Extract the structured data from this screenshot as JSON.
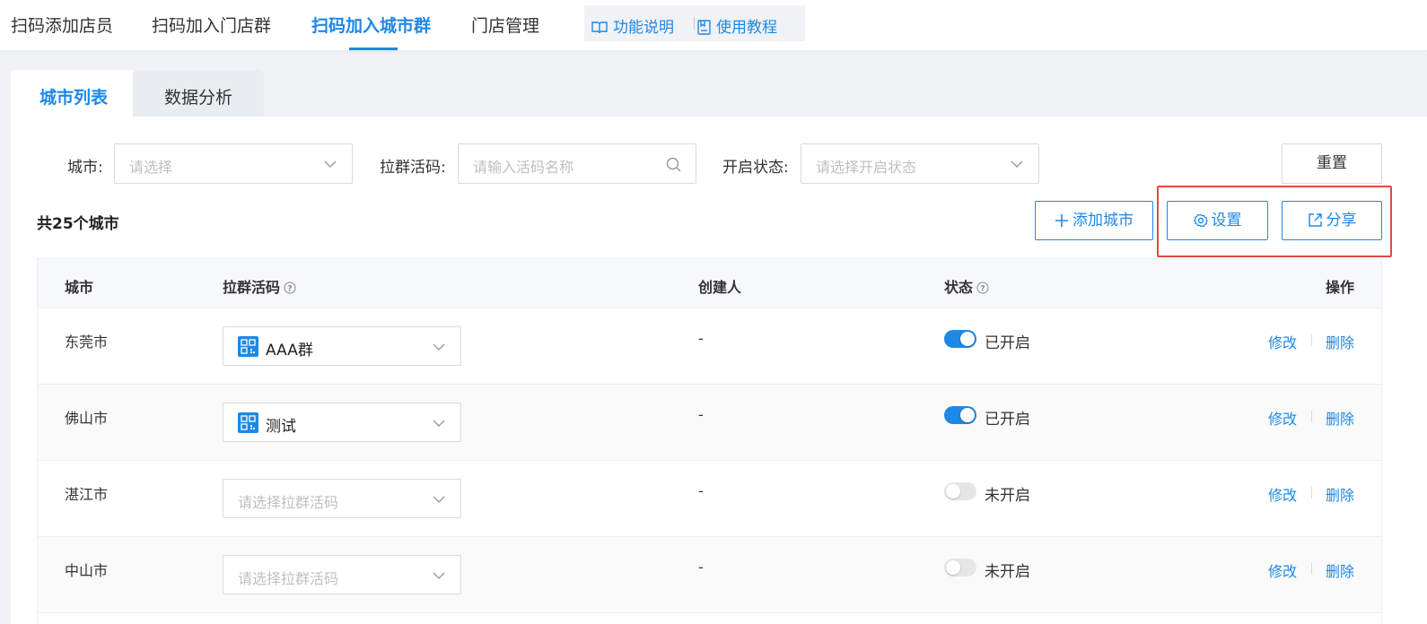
{
  "nav": {
    "tabs": [
      "扫码添加店员",
      "扫码加入门店群",
      "扫码加入城市群",
      "门店管理"
    ],
    "active_index": 2,
    "feature_label": "功能说明",
    "tutorial_label": "使用教程"
  },
  "subtabs": [
    "城市列表",
    "数据分析"
  ],
  "filters": {
    "city_label": "城市:",
    "city_placeholder": "请选择",
    "code_label": "拉群活码:",
    "code_placeholder": "请输入活码名称",
    "status_label": "开启状态:",
    "status_placeholder": "请选择开启状态",
    "reset_label": "重置"
  },
  "summary": "共25个城市",
  "actions": {
    "add_city": "添加城市",
    "settings": "设置",
    "share": "分享"
  },
  "table": {
    "headers": {
      "city": "城市",
      "code": "拉群活码",
      "creator": "创建人",
      "status": "状态",
      "ops": "操作"
    },
    "rows": [
      {
        "city": "东莞市",
        "code": "AAA群",
        "code_placeholder": "",
        "creator": "-",
        "enabled": true,
        "status": "已开启",
        "edit": "修改",
        "delete": "删除"
      },
      {
        "city": "佛山市",
        "code": "测试",
        "code_placeholder": "",
        "creator": "-",
        "enabled": true,
        "status": "已开启",
        "edit": "修改",
        "delete": "删除"
      },
      {
        "city": "湛江市",
        "code": "",
        "code_placeholder": "请选择拉群活码",
        "creator": "-",
        "enabled": false,
        "status": "未开启",
        "edit": "修改",
        "delete": "删除"
      },
      {
        "city": "中山市",
        "code": "",
        "code_placeholder": "请选择拉群活码",
        "creator": "-",
        "enabled": false,
        "status": "未开启",
        "edit": "修改",
        "delete": "删除"
      }
    ]
  },
  "colors": {
    "accent": "#1e88e5",
    "highlight": "#e04a43"
  }
}
